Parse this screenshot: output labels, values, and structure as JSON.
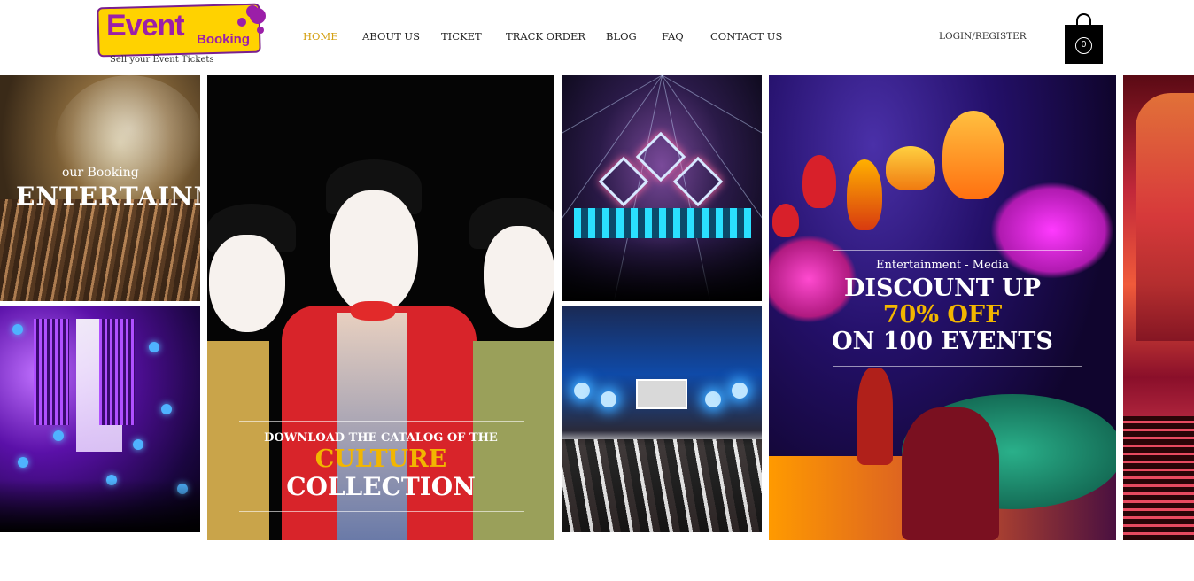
{
  "header": {
    "logo": {
      "word1": "Event",
      "word2": "Booking",
      "tagline": "Sell your Event Tickets"
    },
    "nav": [
      {
        "label": "HOME",
        "active": true
      },
      {
        "label": "ABOUT US",
        "active": false
      },
      {
        "label": "TICKET",
        "active": false
      },
      {
        "label": "TRACK ORDER",
        "active": false
      },
      {
        "label": "BLOG",
        "active": false
      },
      {
        "label": "FAQ",
        "active": false
      },
      {
        "label": "CONTACT US",
        "active": false
      }
    ],
    "login_label": "LOGIN/REGISTER",
    "cart_count": "0"
  },
  "tiles": {
    "booking": {
      "subtitle": "our Booking",
      "title": "ENTERTAINM"
    },
    "culture": {
      "line1": "DOWNLOAD THE CATALOG OF THE",
      "line2": "CULTURE",
      "line3": "COLLECTION"
    },
    "discount": {
      "line1": "Entertainment - Media",
      "line2": "DISCOUNT UP",
      "line3": "70% OFF",
      "line4": "ON 100 EVENTS"
    }
  },
  "colors": {
    "accent": "#f2b600",
    "logo_yellow": "#ffd200",
    "logo_purple": "#9b1fa8",
    "nav_active": "#d4a012"
  }
}
